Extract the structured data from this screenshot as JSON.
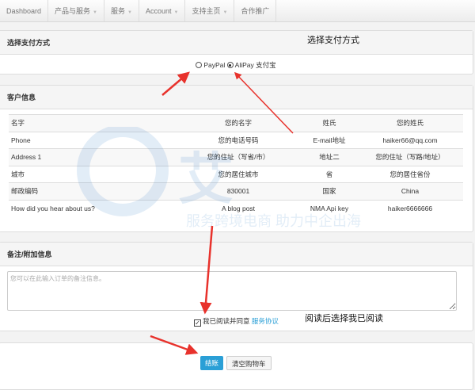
{
  "nav": {
    "items": [
      {
        "label": "Dashboard",
        "caret": false
      },
      {
        "label": "产品与服务",
        "caret": true
      },
      {
        "label": "服务",
        "caret": true
      },
      {
        "label": "Account",
        "caret": true
      },
      {
        "label": "支持主页",
        "caret": true
      },
      {
        "label": "合作推广",
        "caret": false
      }
    ]
  },
  "payment": {
    "title": "选择支付方式",
    "options": [
      {
        "label": "PayPal",
        "selected": false
      },
      {
        "label": "AliPay 支付宝",
        "selected": true
      }
    ]
  },
  "customer": {
    "title": "客户信息",
    "rows": [
      [
        "名字",
        "您的名字",
        "姓氏",
        "您的姓氏"
      ],
      [
        "Phone",
        "您的电话号码",
        "E-mail地址",
        "haiker66@qq.com"
      ],
      [
        "Address 1",
        "您的住址（写省/市）",
        "地址二",
        "您的住址（写路/地址）"
      ],
      [
        "城市",
        "您的居住城市",
        "省",
        "您的居住省份"
      ],
      [
        "邮政编码",
        "830001",
        "国家",
        "China"
      ],
      [
        "How did you hear about us?",
        "A blog post",
        "NMA Api key",
        "haiker6666666"
      ]
    ]
  },
  "notes": {
    "title": "备注/附加信息",
    "placeholder": "您可以在此输入订单的备注信息。",
    "agree_label": "我已阅读并同意",
    "agree_link": "服务协议",
    "agreed": true
  },
  "actions": {
    "checkout": "结账",
    "clear_cart": "清空购物车"
  },
  "annotations": {
    "payment_note": "选择支付方式",
    "read_note": "阅读后选择我已阅读"
  },
  "watermark": {
    "text": "服务跨境电商 助力中企出海"
  },
  "colors": {
    "accent": "#2a9fd6",
    "link": "#2a9fd6",
    "arrow": "#e8322c"
  }
}
